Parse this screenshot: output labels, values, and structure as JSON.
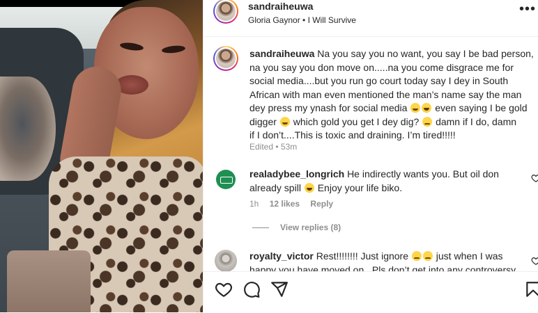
{
  "post": {
    "username": "sandraiheuwa",
    "audio": "Gloria Gaynor • I Will Survive"
  },
  "caption": {
    "username": "sandraiheuwa",
    "lines": [
      "Na you say you no want, you say I be bad person,",
      "na you say you don move on.....na you come disgrace me for",
      "social media....but you run go court today say I dey in South",
      "African with man even mentioned the man’s name say the man",
      "dey press my ynash for social media",
      "even saying I be gold",
      "digger",
      "which gold you get I dey dig?",
      "damn if I do, damn",
      "if I don’t....This is toxic and draining. I’m tired!!!!!"
    ],
    "meta": "Edited • 53m"
  },
  "comments": [
    {
      "username": "realadybee_longrich",
      "text_line1": "He indirectly wants you. But oil don",
      "text_line2_a": "already spill",
      "text_line2_b": "Enjoy your life biko.",
      "time": "1h",
      "likes": "12 likes",
      "reply": "Reply",
      "view_replies": "View replies (8)"
    },
    {
      "username": "royalty_victor",
      "text_line1_a": "Rest!!!!!!!! Just ignore",
      "text_line1_b": "just when I was",
      "text_line2": "happy you have moved on . Pls don’t get into any controversy"
    }
  ],
  "icons": {
    "like": "heart-icon",
    "comment": "comment-icon",
    "share": "share-icon",
    "save": "bookmark-icon",
    "more": "more-icon"
  }
}
